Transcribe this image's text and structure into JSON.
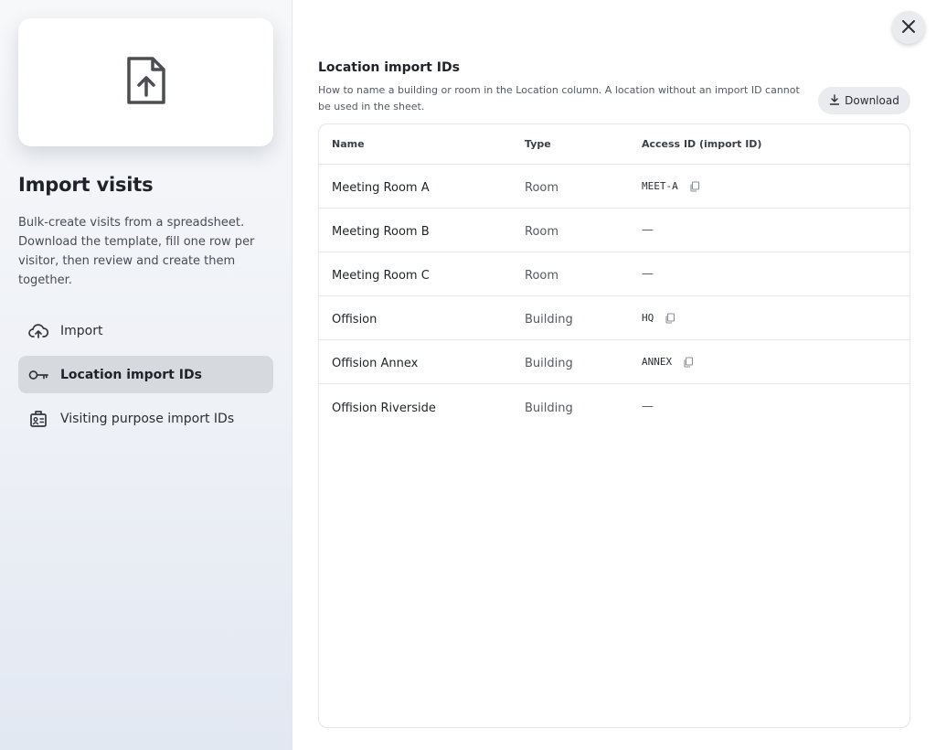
{
  "sidebar": {
    "title": "Import visits",
    "description": "Bulk-create visits from a spreadsheet. Download the template, fill one row per visitor, then review and create them together.",
    "hero_icon": "file-upload-icon",
    "nav": [
      {
        "label": "Import",
        "icon": "cloud-upload-icon",
        "active": false
      },
      {
        "label": "Location import IDs",
        "icon": "key-icon",
        "active": true
      },
      {
        "label": "Visiting purpose import IDs",
        "icon": "badge-icon",
        "active": false
      }
    ]
  },
  "panel": {
    "title": "Location import IDs",
    "description": "How to name a building or room in the Location column. A location without an import ID cannot be used in the sheet.",
    "download_label": "Download",
    "columns": [
      "Name",
      "Type",
      "Access ID (import ID)"
    ],
    "rows": [
      {
        "name": "Meeting Room A",
        "type": "Room",
        "access_id": "MEET-A"
      },
      {
        "name": "Meeting Room B",
        "type": "Room",
        "access_id": "—"
      },
      {
        "name": "Meeting Room C",
        "type": "Room",
        "access_id": "—"
      },
      {
        "name": "Offision",
        "type": "Building",
        "access_id": "HQ"
      },
      {
        "name": "Offision Annex",
        "type": "Building",
        "access_id": "ANNEX"
      },
      {
        "name": "Offision Riverside",
        "type": "Building",
        "access_id": "—"
      }
    ]
  }
}
